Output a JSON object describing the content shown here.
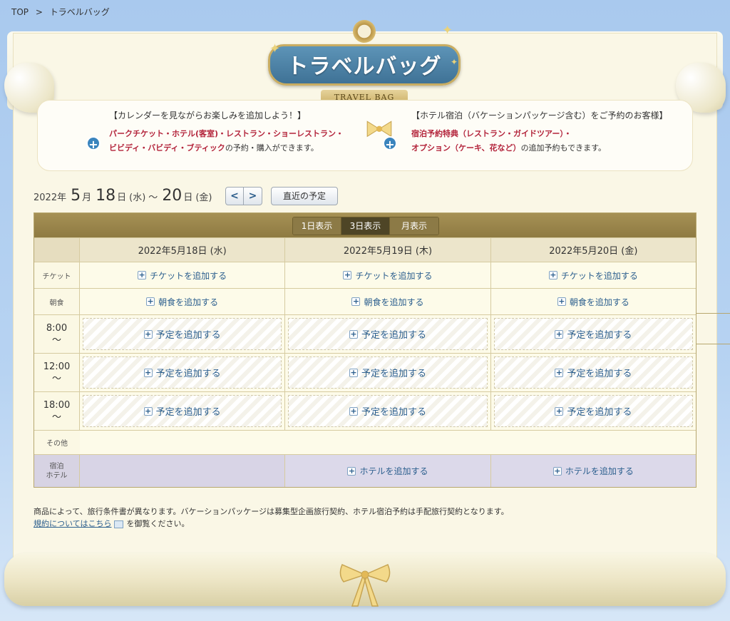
{
  "breadcrumb": {
    "top": "TOP",
    "sep": ">",
    "current": "トラベルバッグ"
  },
  "header": {
    "title": "トラベルバッグ",
    "subtitle": "TRAVEL BAG"
  },
  "info": {
    "left": {
      "heading": "【カレンダーを見ながらお楽しみを追加しよう！】",
      "line1": "パークチケット・ホテル(客室)・レストラン・ショーレストラン・",
      "line2_red": "ビビディ・バビディ・ブティック",
      "line2_rest": "の予約・購入ができます。"
    },
    "right": {
      "heading": "【ホテル宿泊（バケーションパッケージ含む）をご予約のお客様】",
      "line1": "宿泊予約特典（レストラン・ガイドツアー）・",
      "line2_red": "オプション（ケーキ、花など）",
      "line2_rest": "の追加予約もできます。"
    }
  },
  "date_range": {
    "year": "2022",
    "year_unit": "年",
    "month": "5",
    "month_unit": "月",
    "start_day": "18",
    "day_unit": "日",
    "start_dow": "(水)",
    "tilde": "～",
    "end_day": "20",
    "end_dow": "(金)"
  },
  "nav": {
    "prev": "<",
    "next": ">",
    "recent": "直近の予定"
  },
  "view_modes": {
    "day1": "1日表示",
    "day3": "3日表示",
    "month": "月表示",
    "active": "3日表示"
  },
  "days": [
    {
      "label": "2022年5月18日 (水)"
    },
    {
      "label": "2022年5月19日 (木)"
    },
    {
      "label": "2022年5月20日 (金)"
    }
  ],
  "rows": {
    "ticket": {
      "label": "チケット",
      "action": "チケットを追加する"
    },
    "breakfast": {
      "label": "朝食",
      "action": "朝食を追加する"
    },
    "t8": {
      "label": "8:00",
      "tilde": "～",
      "action": "予定を追加する"
    },
    "t12": {
      "label": "12:00",
      "tilde": "～",
      "action": "予定を追加する"
    },
    "t18": {
      "label": "18:00",
      "tilde": "～",
      "action": "予定を追加する"
    },
    "other": {
      "label": "その他"
    },
    "hotel": {
      "label1": "宿泊",
      "label2": "ホテル",
      "action": "ホテルを追加する"
    }
  },
  "footer_note": {
    "line1": "商品によって、旅行条件書が異なります。バケーションパッケージは募集型企画旅行契約、ホテル宿泊予約は手配旅行契約となります。",
    "link": "規約についてはこちら",
    "line2_rest": "を御覧ください。"
  },
  "colors": {
    "accent": "#2c5f8e",
    "red": "#b3243b",
    "gold": "#a69155",
    "sky": "#a9c9ee"
  }
}
